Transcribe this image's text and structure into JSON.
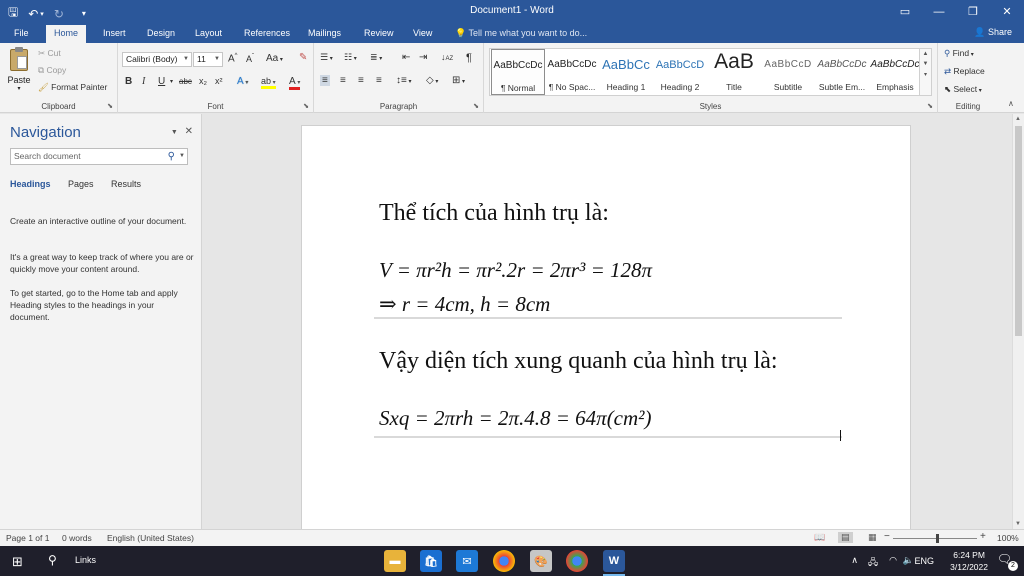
{
  "titlebar": {
    "title": "Document1 - Word",
    "undo": "↶",
    "undo_dropdown": "▾",
    "redo": "↻",
    "customize": "▾"
  },
  "tabs": [
    {
      "label": "File",
      "active": false
    },
    {
      "label": "Home",
      "active": true
    },
    {
      "label": "Insert",
      "active": false
    },
    {
      "label": "Design",
      "active": false
    },
    {
      "label": "Layout",
      "active": false
    },
    {
      "label": "References",
      "active": false
    },
    {
      "label": "Mailings",
      "active": false
    },
    {
      "label": "Review",
      "active": false
    },
    {
      "label": "View",
      "active": false
    }
  ],
  "tell_me": "Tell me what you want to do...",
  "share": "Share",
  "clipboard": {
    "paste": "Paste",
    "cut": "Cut",
    "copy": "Copy",
    "format_painter": "Format Painter",
    "group_label": "Clipboard"
  },
  "font": {
    "family": "Calibri (Body)",
    "size": "11",
    "group_label": "Font",
    "grow": "A",
    "shrink": "A",
    "change_case": "Aa",
    "bold": "B",
    "italic": "I",
    "underline": "U",
    "strikethrough": "abc",
    "subscript": "x₂",
    "superscript": "x²",
    "text_effects": "A",
    "highlight": "ab",
    "font_color": "A"
  },
  "paragraph": {
    "group_label": "Paragraph",
    "pilcrow": "¶"
  },
  "styles": {
    "group_label": "Styles",
    "items": [
      {
        "preview": "AaBbCcDc",
        "name": "¶ Normal"
      },
      {
        "preview": "AaBbCcDc",
        "name": "¶ No Spac..."
      },
      {
        "preview": "AaBbCc",
        "name": "Heading 1"
      },
      {
        "preview": "AaBbCcD",
        "name": "Heading 2"
      },
      {
        "preview": "AaB",
        "name": "Title"
      },
      {
        "preview": "AaBbCcD",
        "name": "Subtitle"
      },
      {
        "preview": "AaBbCcDc",
        "name": "Subtle Em..."
      },
      {
        "preview": "AaBbCcDc",
        "name": "Emphasis"
      }
    ]
  },
  "editing": {
    "group_label": "Editing",
    "find": "Find",
    "replace": "Replace",
    "select": "Select"
  },
  "navigation": {
    "title": "Navigation",
    "search_placeholder": "Search document",
    "tabs": [
      "Headings",
      "Pages",
      "Results"
    ],
    "paragraphs": [
      "Create an interactive outline of your document.",
      "It's a great way to keep track of where you are or quickly move your content around.",
      "To get started, go to the Home tab and apply Heading styles to the headings in your document."
    ]
  },
  "document": {
    "line1": "Thể tích của hình trụ là:",
    "eq1": "V = πr²h = πr².2r = 2πr³ = 128π",
    "eq2": "⇒ r = 4cm, h = 8cm",
    "line2": "Vậy diện tích xung quanh của hình trụ là:",
    "eq3": "Sxq = 2πrh = 2π.4.8 = 64π(cm²)"
  },
  "status": {
    "page": "Page 1 of 1",
    "words": "0 words",
    "language": "English (United States)",
    "zoom": "100%",
    "zoom_out": "−",
    "zoom_in": "+"
  },
  "taskbar": {
    "links": "Links",
    "language": "ENG",
    "time": "6:24 PM",
    "date": "3/12/2022",
    "notifications": "2",
    "word_app": "W"
  }
}
